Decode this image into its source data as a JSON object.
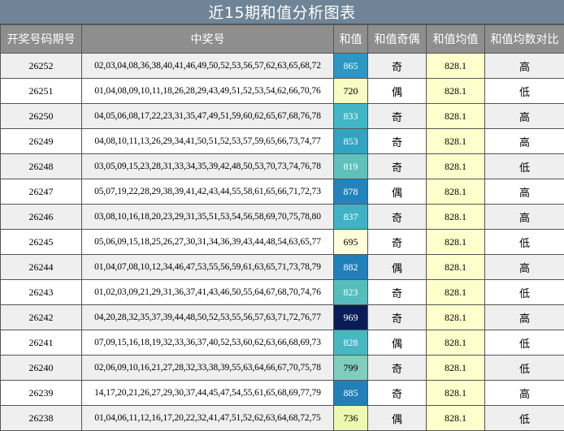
{
  "title": "近15期和值分析图表",
  "headers": [
    "开奖号码期号",
    "中奖号",
    "和值",
    "和值奇偶",
    "和值均值",
    "和值均数对比"
  ],
  "rows": [
    {
      "issue": "26252",
      "numbers": "02,03,04,08,36,38,40,41,46,49,50,52,53,56,57,62,63,65,68,72",
      "sum": "865",
      "parity": "奇",
      "avg": "828.1",
      "compare": "高",
      "sum_color": "#2c97c2"
    },
    {
      "issue": "26251",
      "numbers": "01,04,08,09,10,11,18,26,28,29,43,49,51,52,53,54,62,66,70,76",
      "sum": "720",
      "parity": "偶",
      "avg": "828.1",
      "compare": "低",
      "sum_color": "#f7fcc4"
    },
    {
      "issue": "26250",
      "numbers": "04,05,06,08,17,22,23,31,35,47,49,51,59,60,62,65,67,68,76,78",
      "sum": "833",
      "parity": "奇",
      "avg": "828.1",
      "compare": "高",
      "sum_color": "#41b6c4"
    },
    {
      "issue": "26249",
      "numbers": "04,08,10,11,13,26,29,34,41,50,51,52,53,57,59,65,66,73,74,77",
      "sum": "853",
      "parity": "奇",
      "avg": "828.1",
      "compare": "高",
      "sum_color": "#32a4c2"
    },
    {
      "issue": "26248",
      "numbers": "03,05,09,15,23,28,31,33,34,35,39,42,48,50,53,70,73,74,76,78",
      "sum": "819",
      "parity": "奇",
      "avg": "828.1",
      "compare": "低",
      "sum_color": "#5ec1bc"
    },
    {
      "issue": "26247",
      "numbers": "05,07,19,22,28,29,38,39,41,42,43,44,55,58,61,65,66,71,72,73",
      "sum": "878",
      "parity": "偶",
      "avg": "828.1",
      "compare": "高",
      "sum_color": "#2384bc"
    },
    {
      "issue": "26246",
      "numbers": "03,08,10,16,18,20,23,29,31,35,51,53,54,56,58,69,70,75,78,80",
      "sum": "837",
      "parity": "奇",
      "avg": "828.1",
      "compare": "高",
      "sum_color": "#3fb3c4"
    },
    {
      "issue": "26245",
      "numbers": "05,06,09,15,18,25,26,27,30,31,34,36,39,43,44,48,54,63,65,77",
      "sum": "695",
      "parity": "奇",
      "avg": "828.1",
      "compare": "低",
      "sum_color": "#ffffd9"
    },
    {
      "issue": "26244",
      "numbers": "01,04,07,08,10,12,34,46,47,53,55,56,59,61,63,65,71,73,78,79",
      "sum": "882",
      "parity": "偶",
      "avg": "828.1",
      "compare": "高",
      "sum_color": "#2180ba"
    },
    {
      "issue": "26243",
      "numbers": "01,02,03,09,21,29,31,36,37,41,43,46,50,55,64,67,68,70,74,76",
      "sum": "823",
      "parity": "奇",
      "avg": "828.1",
      "compare": "低",
      "sum_color": "#55bebd"
    },
    {
      "issue": "26242",
      "numbers": "04,20,28,32,35,37,39,44,48,50,52,53,55,56,57,63,71,72,76,77",
      "sum": "969",
      "parity": "奇",
      "avg": "828.1",
      "compare": "高",
      "sum_color": "#081d58"
    },
    {
      "issue": "26241",
      "numbers": "07,09,15,16,18,19,32,33,36,37,40,52,53,60,62,63,66,68,69,73",
      "sum": "828",
      "parity": "偶",
      "avg": "828.1",
      "compare": "低",
      "sum_color": "#47b8c2"
    },
    {
      "issue": "26240",
      "numbers": "02,06,09,10,16,21,27,28,32,33,38,39,55,63,64,66,67,70,75,78",
      "sum": "799",
      "parity": "奇",
      "avg": "828.1",
      "compare": "低",
      "sum_color": "#80cdbb"
    },
    {
      "issue": "26239",
      "numbers": "14,17,20,21,26,27,29,30,37,44,45,47,54,55,61,65,68,69,77,79",
      "sum": "885",
      "parity": "奇",
      "avg": "828.1",
      "compare": "高",
      "sum_color": "#227fb8"
    },
    {
      "issue": "26238",
      "numbers": "01,04,06,11,12,16,17,20,22,32,41,47,51,52,62,63,64,68,72,75",
      "sum": "736",
      "parity": "偶",
      "avg": "828.1",
      "compare": "低",
      "sum_color": "#edf8b1"
    }
  ]
}
